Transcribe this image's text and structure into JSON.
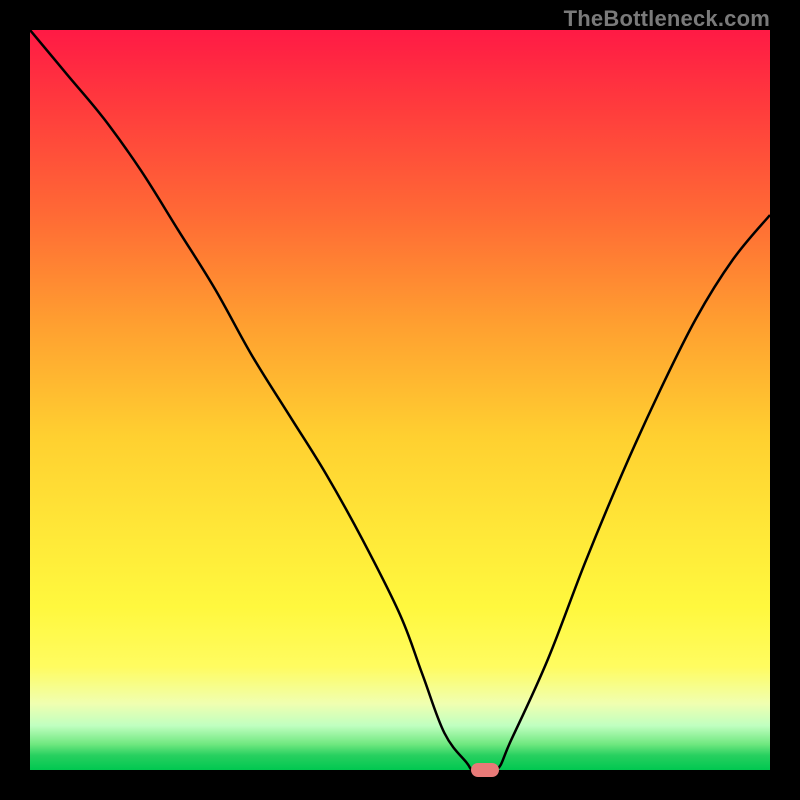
{
  "watermark": "TheBottleneck.com",
  "chart_data": {
    "type": "line",
    "title": "",
    "xlabel": "",
    "ylabel": "",
    "xlim": [
      0,
      100
    ],
    "ylim": [
      0,
      100
    ],
    "grid": false,
    "series": [
      {
        "name": "bottleneck-curve",
        "x": [
          0,
          5,
          10,
          15,
          20,
          25,
          30,
          35,
          40,
          45,
          50,
          53,
          56,
          59,
          60,
          63,
          65,
          70,
          75,
          80,
          85,
          90,
          95,
          100
        ],
        "values": [
          100,
          94,
          88,
          81,
          73,
          65,
          56,
          48,
          40,
          31,
          21,
          13,
          5,
          1,
          0,
          0,
          4,
          15,
          28,
          40,
          51,
          61,
          69,
          75
        ]
      }
    ],
    "minimum_marker": {
      "x": 61.5,
      "y": 0
    },
    "marker_color": "#e87a78",
    "curve_color": "#000000",
    "gradient_stops": [
      {
        "pct": 0,
        "color": "#ff1a45"
      },
      {
        "pct": 10,
        "color": "#ff3a3d"
      },
      {
        "pct": 25,
        "color": "#ff6a35"
      },
      {
        "pct": 40,
        "color": "#ffa030"
      },
      {
        "pct": 55,
        "color": "#ffd030"
      },
      {
        "pct": 68,
        "color": "#ffe838"
      },
      {
        "pct": 78,
        "color": "#fff83e"
      },
      {
        "pct": 86,
        "color": "#fffc60"
      },
      {
        "pct": 91,
        "color": "#f0ffb0"
      },
      {
        "pct": 94,
        "color": "#c0ffc0"
      },
      {
        "pct": 96.5,
        "color": "#70e880"
      },
      {
        "pct": 98,
        "color": "#28d060"
      },
      {
        "pct": 100,
        "color": "#00c850"
      }
    ]
  }
}
